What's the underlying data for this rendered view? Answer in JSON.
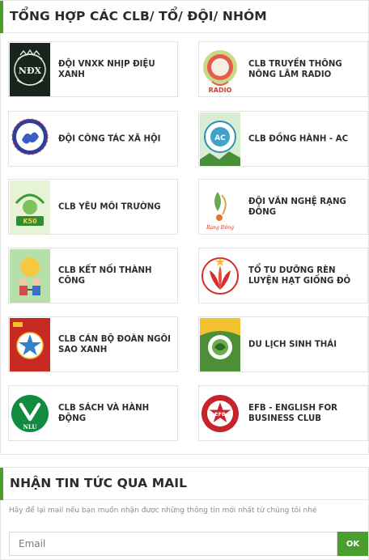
{
  "clubs_panel": {
    "title": "TỔNG HỢP CÁC CLB/ TỔ/ ĐỘI/ NHÓM",
    "accent": "#4a9e2e",
    "clubs": [
      {
        "name": "ĐỘI VNXK NHỊP ĐIỆU XANH",
        "icon": "vnxk-logo-icon"
      },
      {
        "name": "CLB TRUYỀN THÔNG NÔNG LÂM RADIO",
        "icon": "radio-logo-icon"
      },
      {
        "name": "ĐỘI CÔNG TÁC XÃ HỘI",
        "icon": "social-work-logo-icon"
      },
      {
        "name": "CLB ĐỒNG HÀNH - AC",
        "icon": "ac-logo-icon"
      },
      {
        "name": "CLB YÊU MÔI TRƯỜNG",
        "icon": "environment-logo-icon"
      },
      {
        "name": "ĐỘI VĂN NGHỆ RẠNG ĐÔNG",
        "icon": "rang-dong-logo-icon"
      },
      {
        "name": "CLB KẾT NỐI THÀNH CÔNG",
        "icon": "connect-logo-icon"
      },
      {
        "name": "TỔ TU DƯỠNG RÈN LUYỆN HẠT GIỐNG ĐỎ",
        "icon": "red-seed-logo-icon"
      },
      {
        "name": "CLB CÁN BỘ ĐOÀN NGÔI SAO XANH",
        "icon": "green-star-logo-icon"
      },
      {
        "name": "DU LỊCH SINH THÁI",
        "icon": "eco-tourism-logo-icon"
      },
      {
        "name": "CLB SÁCH VÀ HÀNH ĐỘNG",
        "icon": "nlu-book-logo-icon"
      },
      {
        "name": "EFB - ENGLISH FOR BUSINESS CLUB",
        "icon": "efb-logo-icon"
      }
    ],
    "logo_texts": {
      "vnxk": "NĐX",
      "radio": "RADIO",
      "ac": "AC",
      "env": "K50",
      "nlu": "NLU",
      "efb": "EFB",
      "rangdong": "Rạng Đông",
      "efb_ring": "ENGLISH FOR BUSINESS CLUB"
    }
  },
  "mail_panel": {
    "title": "NHẬN TIN TỨC QUA MAIL",
    "description": "Hãy để lại mail nếu bạn muốn nhận được những thông tin mới nhất từ chúng tôi nhé",
    "email_placeholder": "Email",
    "ok_label": "OK"
  }
}
